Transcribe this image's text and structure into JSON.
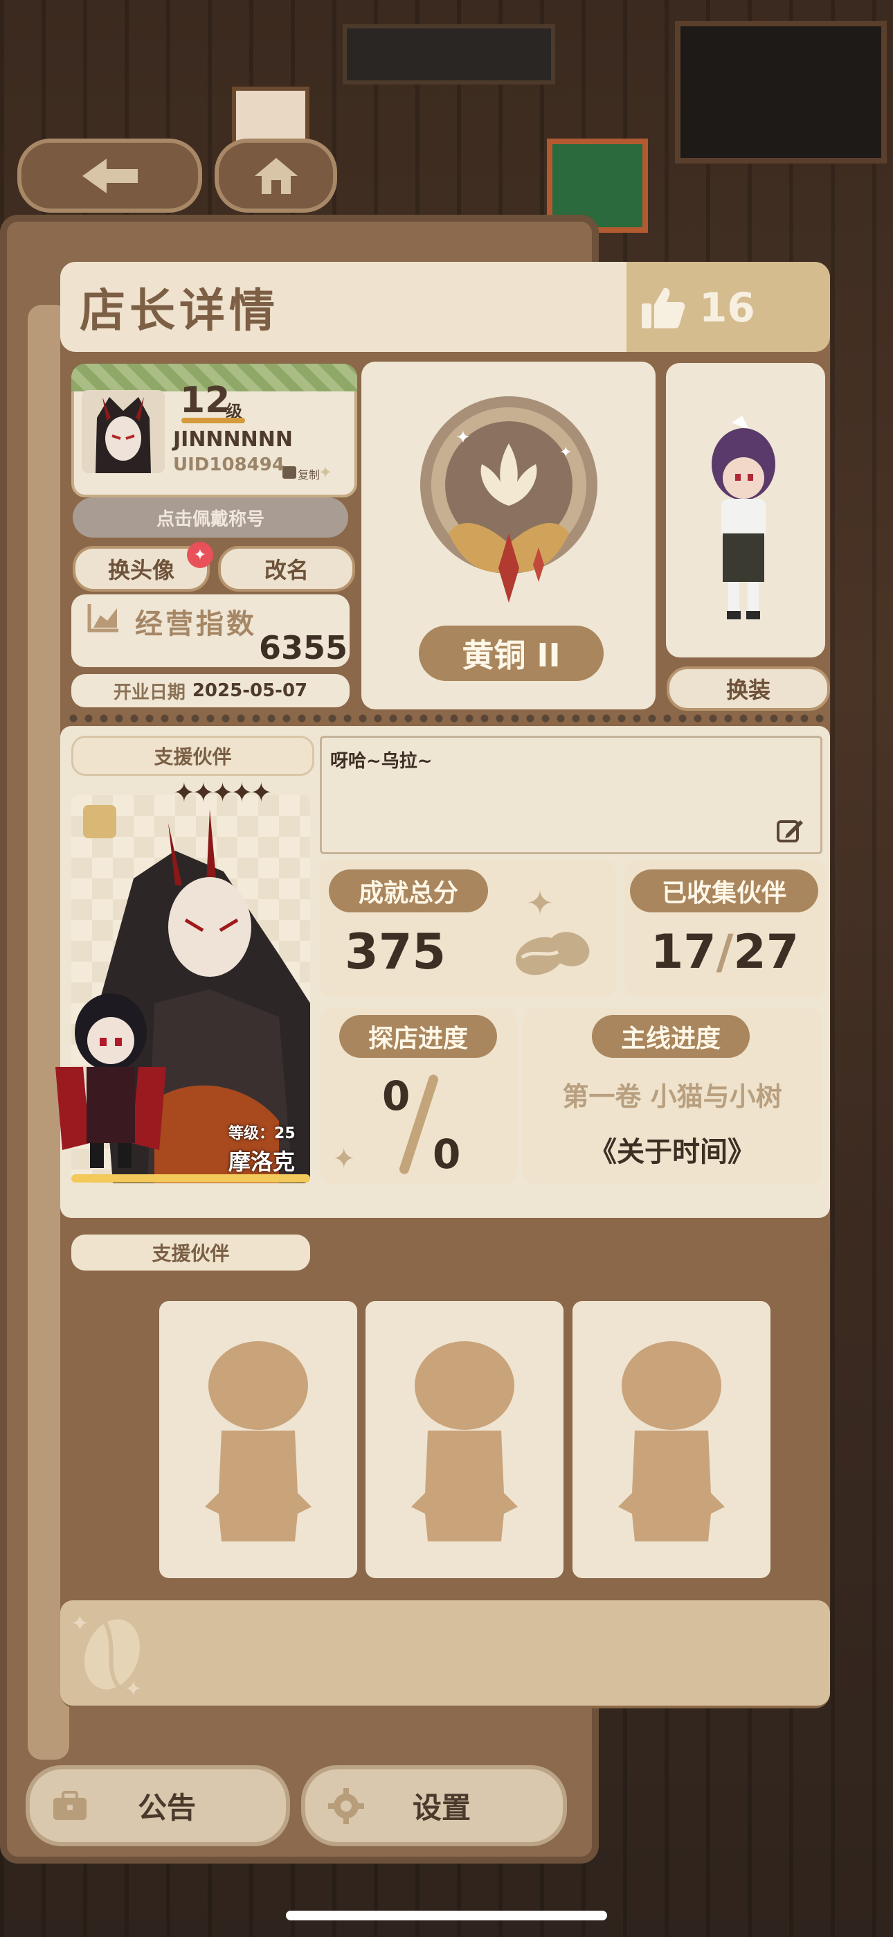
{
  "nav": {
    "back_icon": "arrow-left-icon",
    "home_icon": "home-icon"
  },
  "title": "店长详情",
  "likes": {
    "icon": "thumbs-up-icon",
    "count": "16"
  },
  "profile": {
    "level_number": "12",
    "level_unit": "级",
    "name": "JINNNNNN",
    "uid": "UID108494",
    "copy_label": "复制"
  },
  "actions": {
    "wear_title": "点击佩戴称号",
    "change_avatar": "换头像",
    "rename": "改名",
    "dress_up": "换装"
  },
  "business": {
    "label": "经营指数",
    "value": "6355",
    "open_date_label": "开业日期",
    "open_date": "2025-05-07"
  },
  "rank": {
    "name": "黄铜 II"
  },
  "support": {
    "header": "支援伙伴",
    "partner_level_label": "等级：",
    "partner_level": "25",
    "partner_name": "摩洛克",
    "stars": 5
  },
  "signature": "呀哈~乌拉~",
  "stats": {
    "achievement_label": "成就总分",
    "achievement_value": "375",
    "collected_label": "已收集伙伴",
    "collected_value": "17",
    "collected_total": "27",
    "explore_label": "探店进度",
    "explore_value": "0",
    "explore_total": "0",
    "main_label": "主线进度",
    "main_chapter": "第一卷 小猫与小树",
    "main_episode": "《关于时间》"
  },
  "support2": {
    "header": "支援伙伴",
    "slots": 3
  },
  "bottom": {
    "notice": "公告",
    "settings": "设置"
  },
  "colors": {
    "brown_tag": "#a9865d",
    "cream": "#efe6d5",
    "card": "#8b6849"
  }
}
